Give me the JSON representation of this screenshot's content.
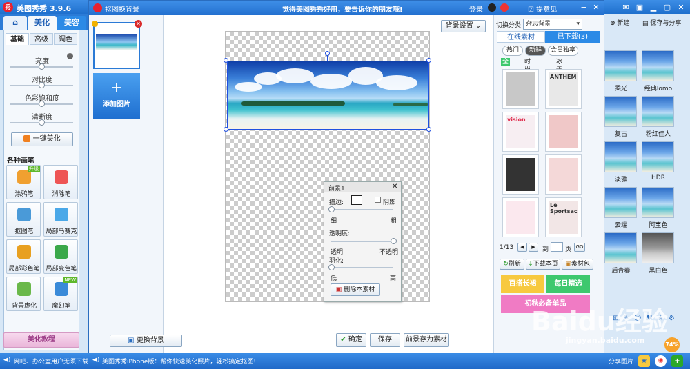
{
  "app": {
    "title": "美图秀秀 3.9.6"
  },
  "colors": {
    "accent": "#2b7bd6",
    "titlebar": "#1d6ecc",
    "pink": "#f07bc4",
    "yellow": "#f7c93f",
    "green": "#3ec86e"
  },
  "main_tabs": [
    {
      "label": "美化"
    },
    {
      "label": "美容"
    }
  ],
  "left": {
    "subtabs": [
      {
        "label": "基础"
      },
      {
        "label": "高级"
      },
      {
        "label": "调色"
      }
    ],
    "sliders": [
      {
        "label": "亮度",
        "level": 0.5
      },
      {
        "label": "对比度",
        "level": 0.5
      },
      {
        "label": "色彩饱和度",
        "level": 0.5
      },
      {
        "label": "清晰度",
        "level": 0.5
      }
    ],
    "one_click": "一键美化",
    "brushes_title": "各种画笔",
    "tools": [
      {
        "label": "涂鸦笔",
        "badge": "升级"
      },
      {
        "label": "消除笔",
        "badge": ""
      },
      {
        "label": "抠图笔",
        "badge": ""
      },
      {
        "label": "局部马赛克",
        "badge": ""
      },
      {
        "label": "局部彩色笔",
        "badge": ""
      },
      {
        "label": "局部变色笔",
        "badge": ""
      },
      {
        "label": "背景虚化",
        "badge": ""
      },
      {
        "label": "魔幻笔",
        "badge": "NEW"
      }
    ],
    "tutorial": "美化教程"
  },
  "dialog": {
    "title": "抠图换背景",
    "slogan": "觉得美图秀秀好用，要告诉你的朋友哦!",
    "login": "登录",
    "feedback": "提意见",
    "add_image": "添加图片",
    "change_bg": "更换背景",
    "bg_settings": "背景设置",
    "fg_panel": {
      "title": "前景1",
      "border_label": "描边:",
      "shadow_label": "阴影",
      "thin": "细",
      "thick": "粗",
      "opacity_label": "透明度:",
      "transparent": "透明",
      "opaque": "不透明",
      "feather_label": "羽化:",
      "low": "低",
      "high": "高",
      "delete": "删除本素材",
      "border_level": 0.0,
      "opacity_level": 1.0,
      "feather_level": 0.0
    },
    "confirm": "确定",
    "save": "保存",
    "save_as_material": "前景存为素材"
  },
  "materials": {
    "category_label": "切换分类",
    "category_value": "杂志背景",
    "tabs": [
      {
        "label": "在线素材"
      },
      {
        "label": "已下载(3)"
      }
    ],
    "pills": [
      {
        "label": "热门"
      },
      {
        "label": "新鲜"
      },
      {
        "label": "会员独享"
      }
    ],
    "filters": [
      {
        "label": "全部"
      },
      {
        "label": "时尚girl"
      },
      {
        "label": "冰雪girl"
      }
    ],
    "items": [
      {
        "caption": ""
      },
      {
        "caption": "ANTHEM"
      },
      {
        "caption": "vision"
      },
      {
        "caption": ""
      },
      {
        "caption": ""
      },
      {
        "caption": ""
      },
      {
        "caption": ""
      },
      {
        "caption": "Le Sportsac"
      }
    ],
    "pager": {
      "page": "1/13",
      "goto": "到",
      "unit": "页",
      "go": "GO"
    },
    "refresh": "刷新",
    "download_page": "下载本页",
    "material_pack": "素材包",
    "banners": [
      {
        "label": "百搭长裙"
      },
      {
        "label": "每日精选"
      },
      {
        "label": "初秋必备单品"
      }
    ]
  },
  "right_strip": {
    "new": "新建",
    "save_share": "保存与分享",
    "effects": [
      {
        "label": "柔光"
      },
      {
        "label": "经典lomo"
      },
      {
        "label": "复古"
      },
      {
        "label": "粉红佳人"
      },
      {
        "label": "淡雅"
      },
      {
        "label": "HDR"
      },
      {
        "label": "云端"
      },
      {
        "label": "阿宝色"
      },
      {
        "label": "后青春"
      },
      {
        "label": "黑白色"
      }
    ],
    "share": "分享图片",
    "progress": "74%"
  },
  "status": {
    "left_msg": "网吧、办公室用户无须下载",
    "mid_msg": "美图秀秀iPhone版：帮你快速美化照片，轻松搞定抠图!"
  },
  "watermark": {
    "text": "Baidu经验",
    "sub": "jingyan.baidu.com"
  }
}
